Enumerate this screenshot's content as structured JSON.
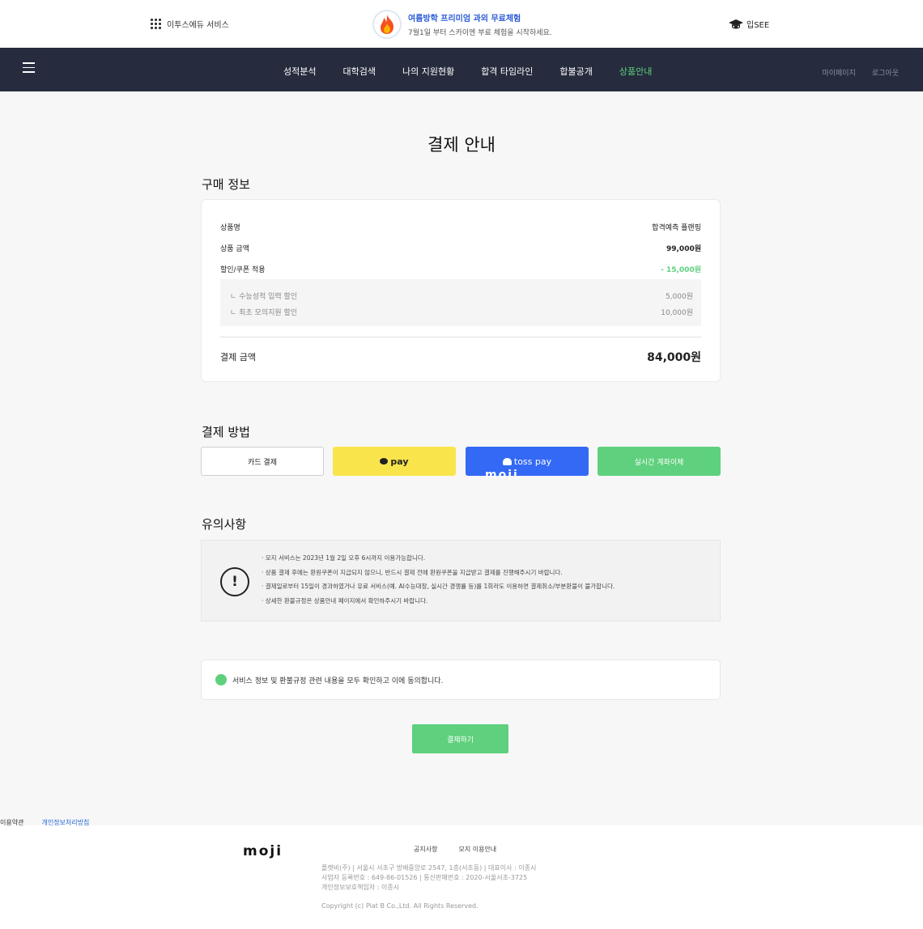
{
  "topbar": {
    "edu_service": "이투스에듀 서비스",
    "promo_title": "여름방학 프리미엄 과외 무료체험",
    "promo_sub": "7월1일 부터 스카이엔 부료 체험을 시작하세요.",
    "brand": "입SEE",
    "icons": {
      "menu": "grid-icon",
      "promo": "fire-icon",
      "brand": "graduation-cap-icon"
    }
  },
  "nav": {
    "items": [
      "성적분석",
      "대학검색",
      "나의 지원현황",
      "합격 타임라인",
      "합불공개",
      "상품안내"
    ],
    "active_index": 5,
    "right": [
      "마이페이지",
      "로그아웃"
    ]
  },
  "page": {
    "title": "결제 안내"
  },
  "purchase": {
    "section_title": "구매 정보",
    "product_label": "상품명",
    "product_value": "합격예측 플랜핑",
    "price_label": "상품 금액",
    "price_value": "99,000원",
    "discount_label": "할인/쿠폰 적용",
    "discount_value": "- 15,000원",
    "discounts": [
      {
        "label": "ㄴ 수능성적 입력 할인",
        "value": "5,000원"
      },
      {
        "label": "ㄴ 최초 모의지원 할인",
        "value": "10,000원"
      }
    ],
    "total_label": "결제 금액",
    "total_value": "84,000원"
  },
  "payment": {
    "section_title": "결제 방법",
    "card": "카드 결제",
    "kakao": "pay",
    "toss": "toss pay",
    "transfer": "실시간 계좌이체",
    "overlay_logo": "moji"
  },
  "notice": {
    "section_title": "유의사항",
    "items": [
      "· 모지 서비스는 2023년 1월 2일 오후 6시까지 이용가능합니다.",
      "· 상품 결제 후에는 환원쿠폰이 지급되지 않으니, 반드시 결제 전에 환원쿠폰을 지급받고 결제를 진행해주시기 바랍니다.",
      "· 결제일로부터 15일이 경과하였거나 유료 서비스(예. AI수능대장, 실시간 경쟁률 등)를 1회라도 이용하면 결제취소/부분환불이 불가합니다.",
      "· 상세한 환불규정은 상품안내 페이지에서 확인하주시기 바랍니다."
    ]
  },
  "agreement": {
    "text": "서비스 정보 및 환불규정 관련 내용을 모두 확인하고 이에 동의합니다."
  },
  "pay_button": "결제하기",
  "terms_links": [
    "이용약관",
    "개인정보처리방침"
  ],
  "footer": {
    "logo": "moji",
    "links": [
      "공지사항",
      "모지 이용안내"
    ],
    "info": [
      "플랫비(주)  |  서울시 서초구 방배중앙로 2547, 1층(서초동)  |  대표이사 : 이종시",
      "사업자 등록번호 : 649-86-01526  |  통신판매번호 : 2020-서울서초-3725",
      "개인정보보호책임자 : 이종시"
    ],
    "copyright": "Copyright (c) Plat B Co.,Ltd. All Rights Reserved."
  },
  "colors": {
    "nav_bg": "#262b3d",
    "accent": "#5fd07d",
    "kakao": "#f9e54b",
    "toss": "#3369f5"
  }
}
